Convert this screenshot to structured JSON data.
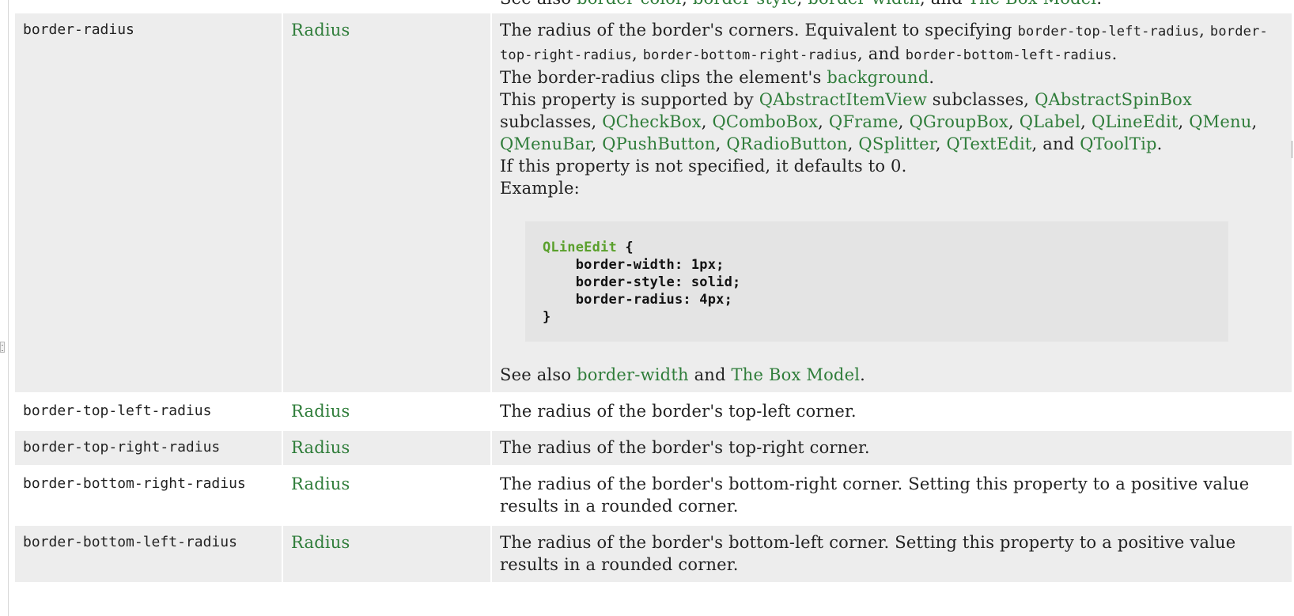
{
  "partial_top": {
    "prefix": "See also ",
    "link1": "border-color",
    "sep1": ", ",
    "link2": "border-style",
    "sep2": ", ",
    "link3": "border-width",
    "mid": ", and ",
    "link4": "The Box Model",
    "end": "."
  },
  "rows": [
    {
      "property": "border-radius",
      "type": "Radius",
      "desc": {
        "l1_text": "The radius of the border's corners. Equivalent to specifying ",
        "l1_code1": "border-top-left-radius",
        "l1_sep1": ", ",
        "l1_code2": "border-top-right-radius",
        "l1_sep2": ", ",
        "l1_code3": "border-bottom-right-radius",
        "l1_and": ", and ",
        "l1_code4": "border-bottom-left-radius",
        "l1_end": ".",
        "l2_text": "The border-radius clips the element's ",
        "l2_link": "background",
        "l2_end": ".",
        "l3_text": "This property is supported by ",
        "supported": [
          {
            "name": "QAbstractItemView",
            "after": " subclasses, "
          },
          {
            "name": "QAbstractSpinBox",
            "after": " subclasses, "
          },
          {
            "name": "QCheckBox",
            "after": ", "
          },
          {
            "name": "QComboBox",
            "after": ", "
          },
          {
            "name": "QFrame",
            "after": ", "
          },
          {
            "name": "QGroupBox",
            "after": ", "
          },
          {
            "name": "QLabel",
            "after": ", "
          },
          {
            "name": "QLineEdit",
            "after": ", "
          },
          {
            "name": "QMenu",
            "after": ", "
          },
          {
            "name": "QMenuBar",
            "after": ", "
          },
          {
            "name": "QPushButton",
            "after": ", "
          },
          {
            "name": "QRadioButton",
            "after": ", "
          },
          {
            "name": "QSplitter",
            "after": ", "
          },
          {
            "name": "QTextEdit",
            "after": ", and "
          },
          {
            "name": "QToolTip",
            "after": "."
          }
        ],
        "l4_text": "If this property is not specified, it defaults to 0.",
        "l5_text": "Example:",
        "code_selector": "QLineEdit",
        "code_open": " {",
        "code_line1": "    border-width: 1px;",
        "code_line2": "    border-style: solid;",
        "code_line3": "    border-radius: 4px;",
        "code_close": "}",
        "see_prefix": "See also ",
        "see_link1": "border-width",
        "see_mid": " and ",
        "see_link2": "The Box Model",
        "see_end": "."
      }
    },
    {
      "property": "border-top-left-radius",
      "type": "Radius",
      "desc": "The radius of the border's top-left corner."
    },
    {
      "property": "border-top-right-radius",
      "type": "Radius",
      "desc": "The radius of the border's top-right corner."
    },
    {
      "property": "border-bottom-right-radius",
      "type": "Radius",
      "desc": "The radius of the border's bottom-right corner. Setting this property to a positive value results in a rounded corner."
    },
    {
      "property": "border-bottom-left-radius",
      "type": "Radius",
      "desc": "The radius of the border's bottom-left corner. Setting this property to a positive value results in a rounded corner."
    }
  ]
}
